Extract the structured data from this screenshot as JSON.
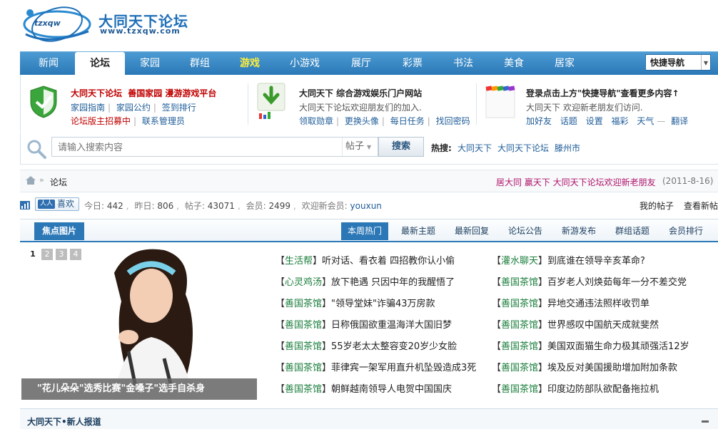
{
  "header": {
    "logo_badge": "tzxqw",
    "site_title": "大同天下论坛",
    "site_url": "www.tzxqw.com"
  },
  "nav": {
    "items": [
      {
        "label": "新闻"
      },
      {
        "label": "论坛"
      },
      {
        "label": "家园"
      },
      {
        "label": "群组"
      },
      {
        "label": "游戏"
      },
      {
        "label": "小游戏"
      },
      {
        "label": "展厅"
      },
      {
        "label": "彩票"
      },
      {
        "label": "书法"
      },
      {
        "label": "美食"
      },
      {
        "label": "居家"
      }
    ],
    "active_index": 1,
    "quick_nav": "快捷导航"
  },
  "panels": {
    "p1": {
      "title_a": "大同天下论坛",
      "title_b": "善国家园 漫游游戏平台",
      "links_row1": [
        "家园指南",
        "家园公约",
        "签到排行"
      ],
      "links_row2": [
        "论坛版主招募中",
        "联系管理员"
      ]
    },
    "p2": {
      "title": "大同天下 综合游戏娱乐门户网站",
      "desc": "大同天下论坛欢迎朋友们的加入.",
      "links": [
        "领取勋章",
        "更换头像",
        "每日任务",
        "找回密码"
      ]
    },
    "p3": {
      "title": "登录点击上方\"快捷导航\"查看更多内容↑",
      "desc": "大同天下 欢迎新老朋友们访问.",
      "links": [
        "加好友",
        "话题",
        "设置",
        "福彩",
        "天气",
        "翻译"
      ]
    }
  },
  "search": {
    "placeholder": "请输入搜索内容",
    "type": "帖子",
    "button": "搜索",
    "hot_label": "热搜:",
    "hot_words": [
      "大同天下",
      "大同天下论坛",
      "滕州市"
    ]
  },
  "breadcrumb": {
    "arrow": "»",
    "current": "论坛",
    "welcome": "居大同 赢天下 大同天下论坛欢迎新老朋友",
    "date": "(2011-8-16)"
  },
  "stats": {
    "like_label": "喜欢",
    "today_label": "今日:",
    "today": "442",
    "yesterday_label": "昨日:",
    "yesterday": "806",
    "posts_label": "帖子:",
    "posts": "43071",
    "members_label": "会员:",
    "members": "2499",
    "newest_label": "欢迎新会员:",
    "newest": "youxun",
    "my_posts": "我的帖子",
    "view_new": "查看新帖"
  },
  "tabs": {
    "focus": "焦点图片",
    "items": [
      "本周热门",
      "最新主题",
      "最新回复",
      "论坛公告",
      "新游发布",
      "群组话题",
      "会员排行"
    ],
    "active_index": 0
  },
  "slideshow": {
    "pages": [
      "1",
      "2",
      "3",
      "4"
    ],
    "active": 0,
    "caption": "\"花儿朵朵\"选秀比赛\"金嗓子\"选手自杀身"
  },
  "news_left": [
    {
      "cat": "生活帮",
      "title": "听对话、看衣着 四招教你认小偷"
    },
    {
      "cat": "心灵鸡汤",
      "title": "放下艳遇 只因中年的我醒悟了"
    },
    {
      "cat": "善国茶馆",
      "title": "\"领导堂妹\"诈骗43万房款"
    },
    {
      "cat": "善国茶馆",
      "title": "日称俄国欲重温海洋大国旧梦"
    },
    {
      "cat": "善国茶馆",
      "title": "55岁老太太整容变20岁少女脸"
    },
    {
      "cat": "善国茶馆",
      "title": "菲律宾一架军用直升机坠毁造成3死"
    },
    {
      "cat": "善国茶馆",
      "title": "朝鲜越南领导人电贺中国国庆"
    }
  ],
  "news_right": [
    {
      "cat": "灌水聊天",
      "title": "到底谁在领导辛亥革命?"
    },
    {
      "cat": "善国茶馆",
      "title": "百岁老人刘焕茹每年一分不差交党"
    },
    {
      "cat": "善国茶馆",
      "title": "异地交通违法照样收罚单"
    },
    {
      "cat": "善国茶馆",
      "title": "世界感叹中国航天成就斐然"
    },
    {
      "cat": "善国茶馆",
      "title": "美国双面猫生命力极其顽强活12岁"
    },
    {
      "cat": "善国茶馆",
      "title": "埃及反对美国援助增加附加条款"
    },
    {
      "cat": "善国茶馆",
      "title": "印度边防部队欲配备拖拉机"
    }
  ],
  "bottom": {
    "title": "大同天下•新人报道"
  },
  "colors": {
    "nav_blue": "#2a78b6",
    "link_blue": "#1f5c99",
    "category_green": "#1a7e3c",
    "welcome_magenta": "#b0136a",
    "panel_red": "#c00000",
    "game_yellow": "#ffef3a"
  }
}
